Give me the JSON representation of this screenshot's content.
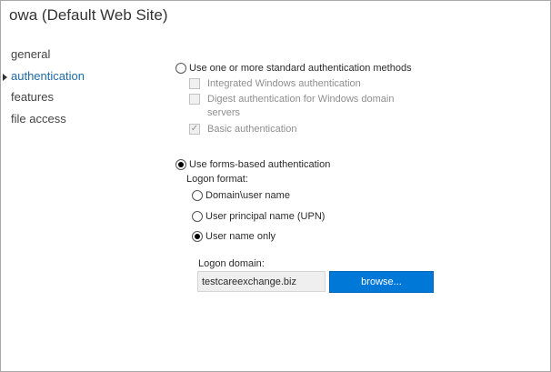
{
  "page": {
    "title": "owa (Default Web Site)"
  },
  "nav": {
    "items": [
      {
        "label": "general"
      },
      {
        "label": "authentication"
      },
      {
        "label": "features"
      },
      {
        "label": "file access"
      }
    ],
    "selected": "authentication"
  },
  "auth": {
    "standard_option": {
      "label": "Use one or more standard authentication methods",
      "selected": false
    },
    "standard_methods": [
      {
        "label": "Integrated Windows authentication",
        "checked": false,
        "enabled": false
      },
      {
        "label_line1": "Digest authentication for Windows domain",
        "label_line2": "servers",
        "checked": false,
        "enabled": false
      },
      {
        "label": "Basic authentication",
        "checked": true,
        "enabled": false
      }
    ],
    "forms_option": {
      "label": "Use forms-based authentication",
      "selected": true
    },
    "logon_format": {
      "label": "Logon format:",
      "options": [
        {
          "label": "Domain\\user name",
          "selected": false
        },
        {
          "label": "User principal name (UPN)",
          "selected": false
        },
        {
          "label": "User name only",
          "selected": true
        }
      ]
    },
    "logon_domain": {
      "label": "Logon domain:",
      "value": "testcareexchange.biz",
      "browse_label": "browse..."
    }
  },
  "colors": {
    "accent": "#0078d7",
    "nav_selected": "#1e6aa8",
    "disabled_text": "#8f8f8f"
  }
}
